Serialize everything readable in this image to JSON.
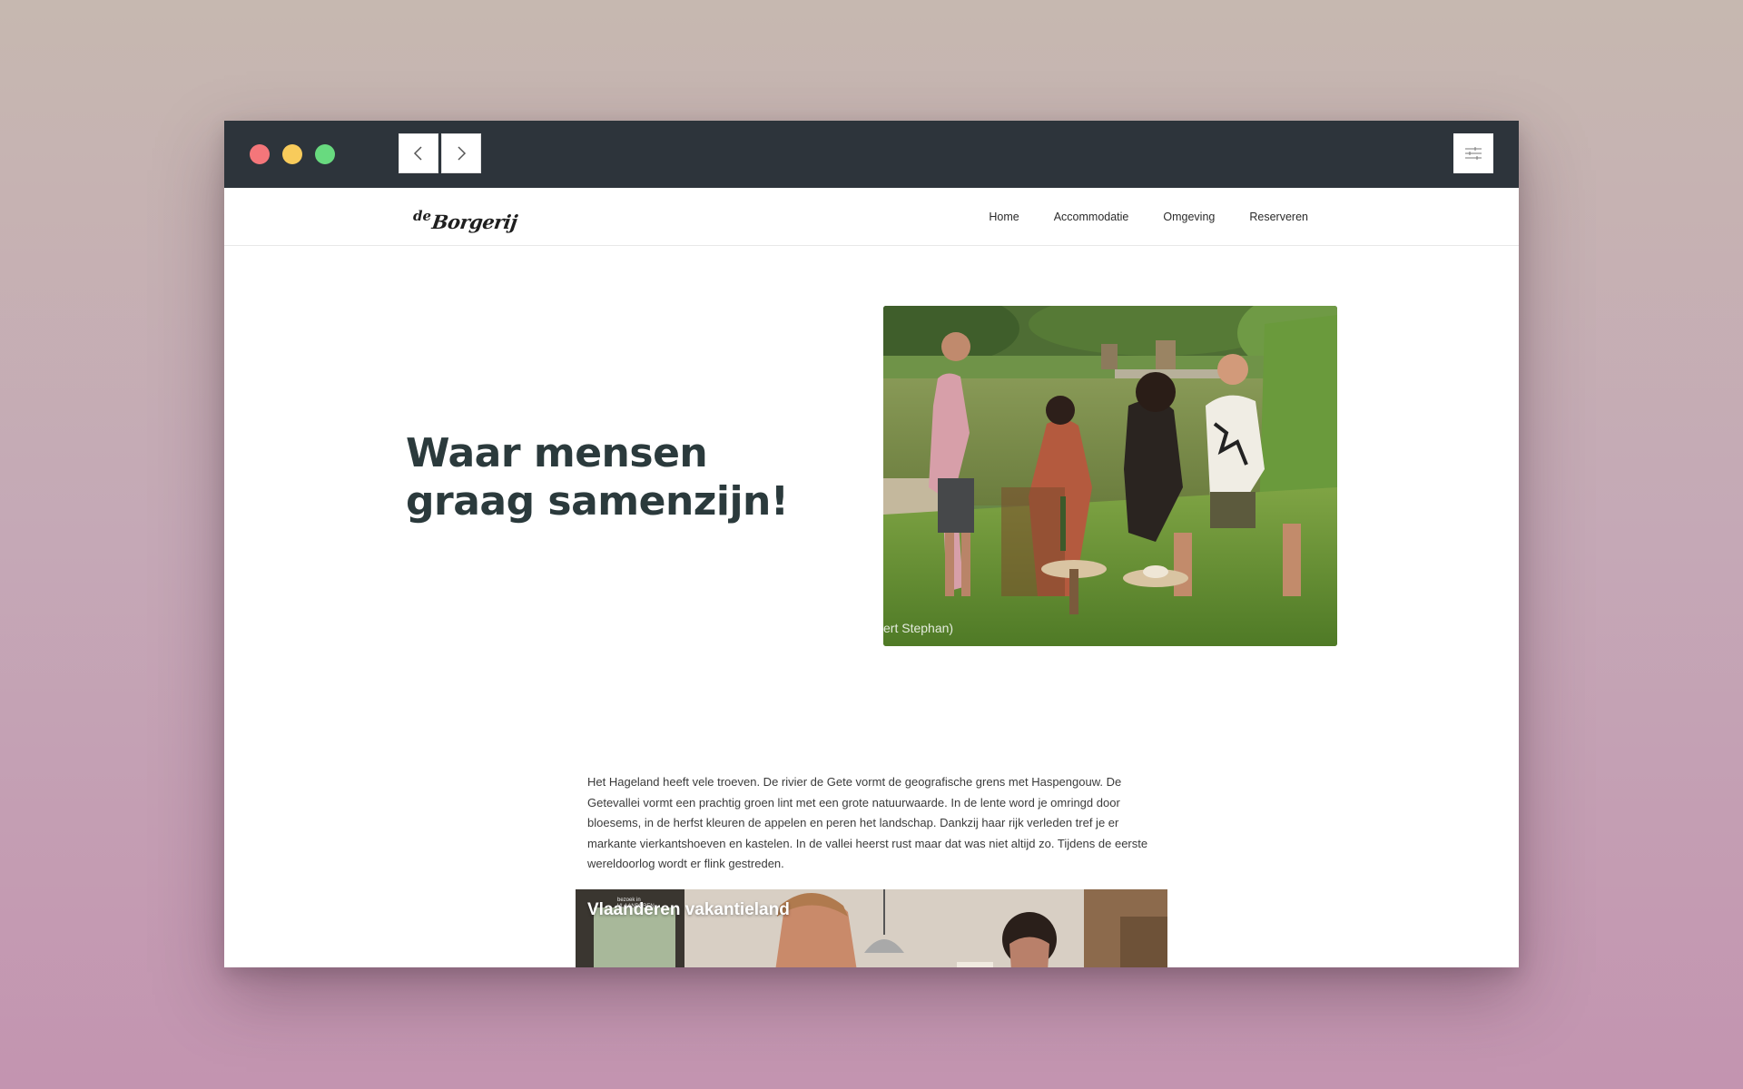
{
  "browser": {
    "traffic_lights": [
      "close",
      "minimize",
      "zoom"
    ],
    "back_icon": "chevron-left-icon",
    "forward_icon": "chevron-right-icon",
    "menu_icon": "sliders-icon"
  },
  "site": {
    "logo_prefix": "de",
    "logo_name": "Borgerij",
    "nav": [
      {
        "label": "Home"
      },
      {
        "label": "Accommodatie"
      },
      {
        "label": "Omgeving"
      },
      {
        "label": "Reserveren"
      }
    ]
  },
  "hero": {
    "title_line1": "Waar mensen",
    "title_line2": "graag samenzijn!",
    "photo_caption": "ert Stephan)"
  },
  "intro": {
    "paragraph": "Het Hageland heeft vele troeven. De rivier de Gete vormt de geografische grens met Haspengouw. De Getevallei vormt een prachtig groen lint met een grote natuurwaarde. In de lente word je omringd door bloesems, in de herfst kleuren de appelen en peren het landschap. Dankzij haar rijk verleden tref je er markante vierkantshoeven en kastelen. In de vallei heerst rust maar dat was niet altijd zo. Tijdens de eerste wereldoorlog wordt er flink gestreden."
  },
  "video": {
    "title": "Vlaanderen vakantieland",
    "badge_line1": "bezoek in",
    "badge_line2": "VLAANDEREN"
  },
  "colors": {
    "titlebar": "#2d343b",
    "heading": "#2b3a3c",
    "red": "#f4767a",
    "yellow": "#f8cb5b",
    "green": "#68da7f"
  }
}
